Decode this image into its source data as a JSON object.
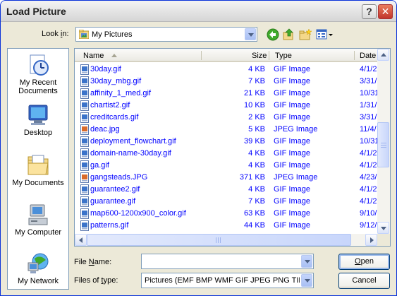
{
  "window": {
    "title": "Load Picture",
    "help_glyph": "?",
    "close_glyph": "✕"
  },
  "lookin": {
    "label_pre": "Look ",
    "label_accel": "i",
    "label_post": "n:",
    "value": "My Pictures",
    "icon": "my-pictures-folder-icon"
  },
  "toolbar": {
    "icons": [
      "back-icon",
      "up-folder-icon",
      "new-folder-icon",
      "views-menu-icon"
    ]
  },
  "places": [
    {
      "label": "My Recent Documents",
      "icon": "recent-documents-icon"
    },
    {
      "label": "Desktop",
      "icon": "desktop-icon"
    },
    {
      "label": "My Documents",
      "icon": "my-documents-icon"
    },
    {
      "label": "My Computer",
      "icon": "my-computer-icon"
    },
    {
      "label": "My Network",
      "icon": "my-network-icon"
    }
  ],
  "columns": {
    "name": "Name",
    "size": "Size",
    "type": "Type",
    "date": "Date"
  },
  "files": [
    {
      "name": "30day.gif",
      "size": "4 KB",
      "type": "GIF Image",
      "date": "4/1/2"
    },
    {
      "name": "30day_mbg.gif",
      "size": "7 KB",
      "type": "GIF Image",
      "date": "3/31/"
    },
    {
      "name": "affinity_1_med.gif",
      "size": "21 KB",
      "type": "GIF Image",
      "date": "10/31"
    },
    {
      "name": "chartist2.gif",
      "size": "10 KB",
      "type": "GIF Image",
      "date": "1/31/"
    },
    {
      "name": "creditcards.gif",
      "size": "2 KB",
      "type": "GIF Image",
      "date": "3/31/"
    },
    {
      "name": "deac.jpg",
      "size": "5 KB",
      "type": "JPEG Image",
      "date": "11/4/"
    },
    {
      "name": "deployment_flowchart.gif",
      "size": "39 KB",
      "type": "GIF Image",
      "date": "10/31"
    },
    {
      "name": "domain-name-30day.gif",
      "size": "4 KB",
      "type": "GIF Image",
      "date": "4/1/2"
    },
    {
      "name": "ga.gif",
      "size": "4 KB",
      "type": "GIF Image",
      "date": "4/1/2"
    },
    {
      "name": "gangsteads.JPG",
      "size": "371 KB",
      "type": "JPEG Image",
      "date": "4/23/"
    },
    {
      "name": "guarantee2.gif",
      "size": "4 KB",
      "type": "GIF Image",
      "date": "4/1/2"
    },
    {
      "name": "guarantee.gif",
      "size": "7 KB",
      "type": "GIF Image",
      "date": "4/1/2"
    },
    {
      "name": "map600-1200x900_color.gif",
      "size": "63 KB",
      "type": "GIF Image",
      "date": "9/10/"
    },
    {
      "name": "patterns.gif",
      "size": "44 KB",
      "type": "GIF Image",
      "date": "9/12/"
    }
  ],
  "filename": {
    "label_accel": "N",
    "label_pre": "File ",
    "label_post": "ame:",
    "value": ""
  },
  "filetype": {
    "label_pre": "Files of ",
    "label_accel": "t",
    "label_post": "ype:",
    "value": "Pictures (EMF BMP WMF GIF JPEG PNG TIFF"
  },
  "buttons": {
    "open_accel": "O",
    "open_rest": "pen",
    "cancel": "Cancel"
  },
  "colors": {
    "link_blue": "#0000ff",
    "window_border": "#0831d9",
    "dialog_face": "#ece9d8"
  }
}
